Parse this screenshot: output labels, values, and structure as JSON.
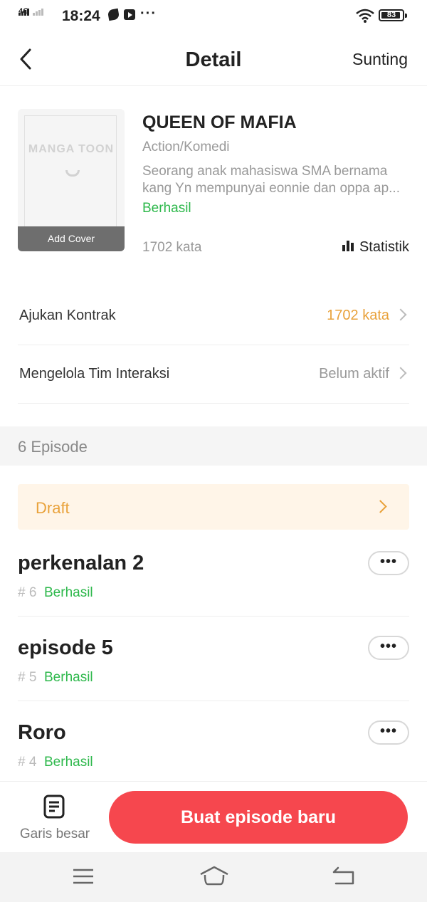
{
  "status_bar": {
    "network": "4G",
    "time": "18:24",
    "more": "···",
    "battery": "83"
  },
  "header": {
    "title": "Detail",
    "edit_label": "Sunting"
  },
  "book": {
    "cover_logo": "MANGA TOON",
    "add_cover_label": "Add Cover",
    "title": "QUEEN OF MAFIA",
    "genre": "Action/Komedi",
    "description_line1": "Seorang anak mahasiswa SMA bernama",
    "description_line2": "kang Yn mempunyai eonnie dan oppa ap...",
    "status": "Berhasil",
    "word_count": "1702 kata",
    "stats_label": "Statistik"
  },
  "rows": [
    {
      "label": "Ajukan Kontrak",
      "value": "1702 kata",
      "value_color": "#e9a23b"
    },
    {
      "label": "Mengelola Tim Interaksi",
      "value": "Belum aktif",
      "value_color": "#999999"
    }
  ],
  "episodes_header": "6 Episode",
  "draft_label": "Draft",
  "episodes": [
    {
      "title": "perkenalan 2",
      "number": "# 6",
      "status": "Berhasil",
      "more": "•••"
    },
    {
      "title": "episode 5",
      "number": "# 5",
      "status": "Berhasil",
      "more": "•••"
    },
    {
      "title": "Roro",
      "number": "# 4",
      "status": "Berhasil",
      "more": "•••"
    }
  ],
  "bottom_bar": {
    "outline_label": "Garis besar",
    "new_episode_label": "Buat episode baru"
  },
  "colors": {
    "accent": "#f6474e",
    "success": "#2db84b",
    "warning": "#e9a23b"
  }
}
